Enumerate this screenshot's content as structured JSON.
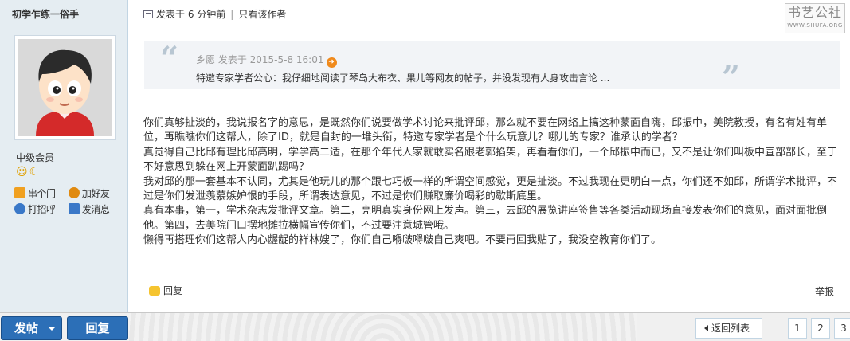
{
  "user": {
    "name": "初学乍练一俗手",
    "level": "中级会员",
    "medals": "☺☾",
    "actions": [
      {
        "label": "串个门",
        "icon": "home-icon",
        "color": "#f0a020"
      },
      {
        "label": "加好友",
        "icon": "add-friend-icon",
        "color": "#e08a10"
      },
      {
        "label": "打招呼",
        "icon": "greet-icon",
        "color": "#3a78c8"
      },
      {
        "label": "发消息",
        "icon": "message-icon",
        "color": "#3a78c8"
      }
    ]
  },
  "post": {
    "posted": "发表于 6 分钟前",
    "separator": "|",
    "author_only": "只看该作者",
    "watermark_cn": "书艺公社",
    "watermark_url": "WWW.SHUFA.ORG",
    "quote": {
      "header": "乡愿 发表于 2015-5-8 16:01",
      "text": "特邀专家学者公心：我仔细地阅读了琴岛大布衣、果儿等网友的帖子，并没发现有人身攻击言论 ...",
      "left_mark": "“",
      "right_mark": "”"
    },
    "paragraphs": [
      "你们真够扯淡的，我说报名字的意思，是既然你们说要做学术讨论来批评邱，那么就不要在网络上搞这种蒙面自嗨，邱振中，美院教授，有名有姓有单位，再瞧瞧你们这帮人，除了ID，就是自封的一堆头衔，特邀专家学者是个什么玩意儿？哪儿的专家？谁承认的学者？",
      "真觉得自己比邱有理比邱高明，学学高二适，在那个年代人家就敢实名跟老郭掐架，再看看你们，一个邱振中而已，又不是让你们叫板中宣部部长，至于不好意思到躲在网上开蒙面趴踢吗？",
      "我对邱的那一套基本不认同，尤其是他玩儿的那个跟七巧板一样的所谓空间感觉，更是扯淡。不过我现在更明白一点，你们还不如邱，所谓学术批评，不过是你们发泄羡慕嫉妒恨的手段，所谓表达意见，不过是你们赚取廉价喝彩的歇斯底里。",
      "真有本事，第一，学术杂志发批评文章。第二，亮明真实身份网上发声。第三，去邱的展览讲座签售等各类活动现场直接发表你们的意见，面对面批倒他。第四，去美院门口摆地摊拉横幅宣传你们，不过要注意城管哦。",
      "懒得再搭理你们这帮人内心龌龊的祥林嫂了，你们自己嘚啵嘚啵自己爽吧。不要再回我贴了，我没空教育你们了。"
    ],
    "reply_label": "回复",
    "report_label": "举报"
  },
  "bottom": {
    "post_button": "发帖",
    "reply_button": "回复",
    "back_button": "返回列表",
    "pages": [
      "1",
      "2",
      "3"
    ]
  }
}
